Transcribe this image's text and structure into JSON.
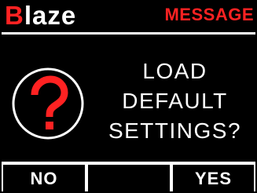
{
  "header": {
    "brand_initial": "B",
    "brand_rest": "laze",
    "title": "MESSAGE"
  },
  "dialog": {
    "icon": "question-mark-circle-icon",
    "lines": [
      "LOAD",
      "DEFAULT",
      "SETTINGS?"
    ]
  },
  "softkeys": [
    {
      "label": "NO"
    },
    {
      "label": ""
    },
    {
      "label": "YES"
    }
  ],
  "colors": {
    "background": "#000000",
    "foreground": "#ffffff",
    "accent": "#ff2222"
  }
}
